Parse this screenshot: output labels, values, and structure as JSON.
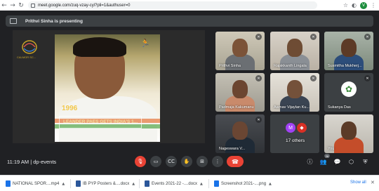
{
  "browser": {
    "url": "meet.google.com/zuq-vzay-cyi?pli=1&authuser=0",
    "profile_initial": "V"
  },
  "presenting": {
    "text": "Prithvi Sinha is presenting"
  },
  "slide": {
    "year": "1996",
    "headline": "LEANDER PAES GETS INDIA'S 1...",
    "logo_text": "CALMOR SC..."
  },
  "participants": [
    {
      "name": "Prithvi Sinha"
    },
    {
      "name": "Rajakkanth Lingala"
    },
    {
      "name": "Susmitha Mukherj..."
    },
    {
      "name": "Padmaja Kakumanu"
    },
    {
      "name": "Aarnav Vijaylan Ku..."
    },
    {
      "name": "Sukanya Das"
    },
    {
      "name": "Nageswara V..."
    },
    {
      "name": "17 others",
      "avatar_initial": "M"
    },
    {
      "name": "You"
    }
  ],
  "meeting": {
    "time": "11:19 AM",
    "code": "dp-events",
    "time_code": "11:19 AM  |  dp-events",
    "people_count": "26"
  },
  "downloads": [
    {
      "name": "NATIONAL SPOR....mp4",
      "color": "#1a73e8"
    },
    {
      "name": "IB PYP Posters &....docx",
      "color": "#2b579a"
    },
    {
      "name": "Events 2021-22 -....docx",
      "color": "#2b579a"
    },
    {
      "name": "Screenshot 2021-....png",
      "color": "#1a73e8"
    }
  ],
  "show_all": "Show all"
}
